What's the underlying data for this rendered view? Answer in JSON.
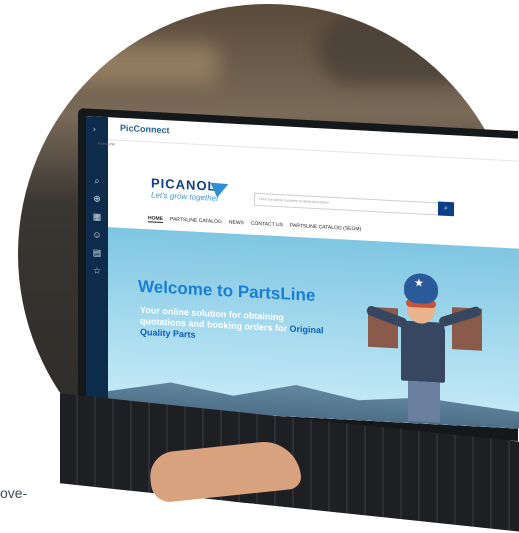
{
  "app": {
    "brand": "PicConnect",
    "breadcrumb": "PartsLine"
  },
  "site": {
    "logo_name": "PICANOL",
    "logo_tagline": "Let's grow together",
    "search_placeholder": "Fill in the article numbers or items description"
  },
  "nav": {
    "items": [
      "HOME",
      "PARTSLINE CATALOG",
      "NEWS",
      "CONTACT US",
      "PARTSLINE CATALOG (SEGM)"
    ]
  },
  "hero": {
    "title": "Welcome to PartsLine",
    "subtitle": "Your online solution for obtaining quotations and booking orders for",
    "subtitle_accent": "Original Quality Parts"
  },
  "page_caption": "ove-"
}
